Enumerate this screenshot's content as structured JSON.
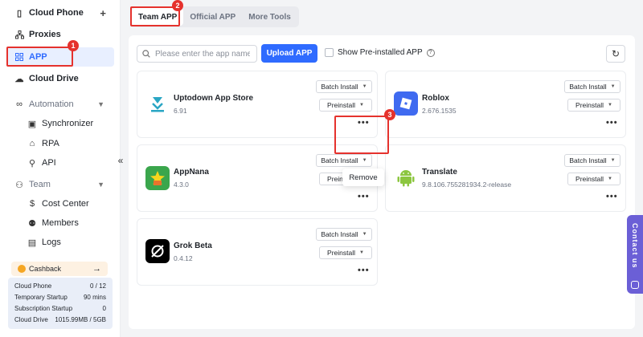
{
  "sidebar": {
    "cloud_phone": "Cloud Phone",
    "add_symbol": "+",
    "proxies": "Proxies",
    "app": "APP",
    "cloud_drive": "Cloud Drive",
    "automation": "Automation",
    "synchronizer": "Synchronizer",
    "rpa": "RPA",
    "api": "API",
    "team": "Team",
    "cost_center": "Cost Center",
    "members": "Members",
    "logs": "Logs",
    "collapse_symbol": "«"
  },
  "cashback": {
    "label": "Cashback",
    "arrow": "→"
  },
  "stats": [
    {
      "label": "Cloud Phone",
      "value": "0 / 12"
    },
    {
      "label": "Temporary Startup",
      "value": "90 mins"
    },
    {
      "label": "Subscription Startup",
      "value": "0"
    },
    {
      "label": "Cloud Drive",
      "value": "1015.99MB / 5GB"
    }
  ],
  "tabs": [
    "Team APP",
    "Official APP",
    "More Tools"
  ],
  "toolbar": {
    "search_placeholder": "Please enter the app name",
    "upload_label": "Upload APP",
    "preinstalled_label": "Show Pre-installed APP",
    "help_symbol": "?",
    "refresh_symbol": "↻"
  },
  "apps": [
    {
      "name": "Uptodown App Store",
      "version": "6.91"
    },
    {
      "name": "Roblox",
      "version": "2.676.1535"
    },
    {
      "name": "AppNana",
      "version": "4.3.0"
    },
    {
      "name": "Translate",
      "version": "9.8.106.755281934.2-release"
    },
    {
      "name": "Grok Beta",
      "version": "0.4.12"
    }
  ],
  "buttons": {
    "batch_install": "Batch Install",
    "preinstall": "Preinstall",
    "more": "•••"
  },
  "popover": {
    "remove": "Remove"
  },
  "annotations": [
    "1",
    "2",
    "3"
  ],
  "contact": "Contact us",
  "colors": {
    "accent": "#2f6bff",
    "annotation": "#e5322d",
    "contact": "#6b5fd6"
  }
}
